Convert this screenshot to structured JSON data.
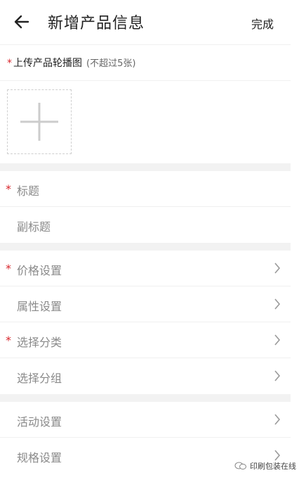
{
  "header": {
    "title": "新增产品信息",
    "done_label": "完成"
  },
  "upload": {
    "required_mark": "*",
    "label": "上传产品轮播图",
    "hint": "(不超过5张)"
  },
  "fields": {
    "title": {
      "required_mark": "*",
      "label": "标题"
    },
    "subtitle": {
      "label": "副标题"
    },
    "price": {
      "required_mark": "*",
      "label": "价格设置"
    },
    "attributes": {
      "label": "属性设置"
    },
    "category": {
      "required_mark": "*",
      "label": "选择分类"
    },
    "group": {
      "label": "选择分组"
    },
    "activity": {
      "label": "活动设置"
    },
    "spec": {
      "label": "规格设置"
    }
  },
  "watermark": {
    "text": "印刷包装在线"
  },
  "colors": {
    "required": "#d9262c",
    "label": "#8a8a8a",
    "divider": "#f2f2f2"
  }
}
